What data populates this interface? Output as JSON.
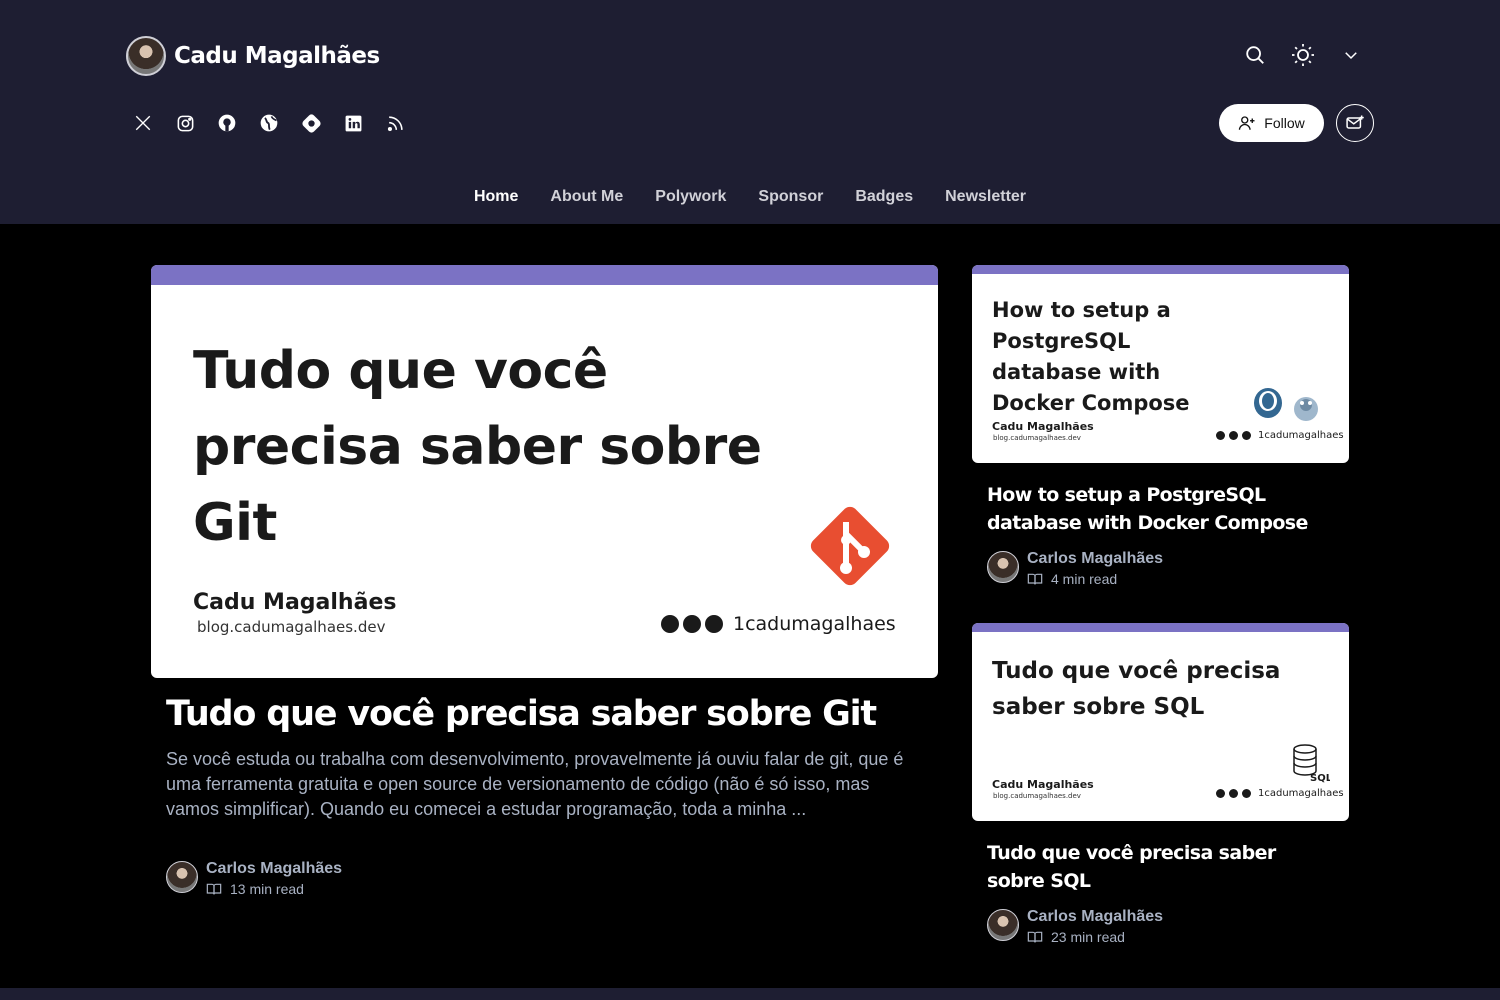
{
  "header": {
    "blog_name": "Cadu Magalhães",
    "follow_label": "Follow",
    "nav": [
      "Home",
      "About Me",
      "Polywork",
      "Sponsor",
      "Badges",
      "Newsletter"
    ],
    "active_nav": "Home",
    "socials": [
      "x-icon",
      "instagram-icon",
      "github-icon",
      "globe-icon",
      "hashnode-icon",
      "linkedin-icon",
      "rss-icon"
    ],
    "accent_color": "#7b72c4"
  },
  "featured": {
    "cover": {
      "title": "Tudo que você precisa saber sobre Git",
      "author": "Cadu Magalhães",
      "site": "blog.cadumagalhaes.dev",
      "handle": "1cadumagalhaes"
    },
    "title": "Tudo que você precisa saber sobre Git",
    "excerpt": "Se você estuda ou trabalha com desenvolvimento, provavelmente já ouviu falar de git, que é uma ferramenta gratuita e open source de versionamento de código (não é só isso, mas vamos simplificar). Quando eu comecei a estudar programação, toda a minha ...",
    "author": "Carlos Magalhães",
    "read_time": "13 min read"
  },
  "side_posts": [
    {
      "cover": {
        "title": "How to setup a PostgreSQL database with Docker Compose",
        "author": "Cadu Magalhães",
        "site": "blog.cadumagalhaes.dev",
        "handle": "1cadumagalhaes"
      },
      "title": "How to setup a PostgreSQL database with Docker Compose",
      "author": "Carlos Magalhães",
      "read_time": "4 min read"
    },
    {
      "cover": {
        "title": "Tudo que você precisa saber sobre SQL",
        "author": "Cadu Magalhães",
        "site": "blog.cadumagalhaes.dev",
        "handle": "1cadumagalhaes",
        "badge": "SQL"
      },
      "title": "Tudo que você precisa saber sobre SQL",
      "author": "Carlos Magalhães",
      "read_time": "23 min read"
    }
  ]
}
